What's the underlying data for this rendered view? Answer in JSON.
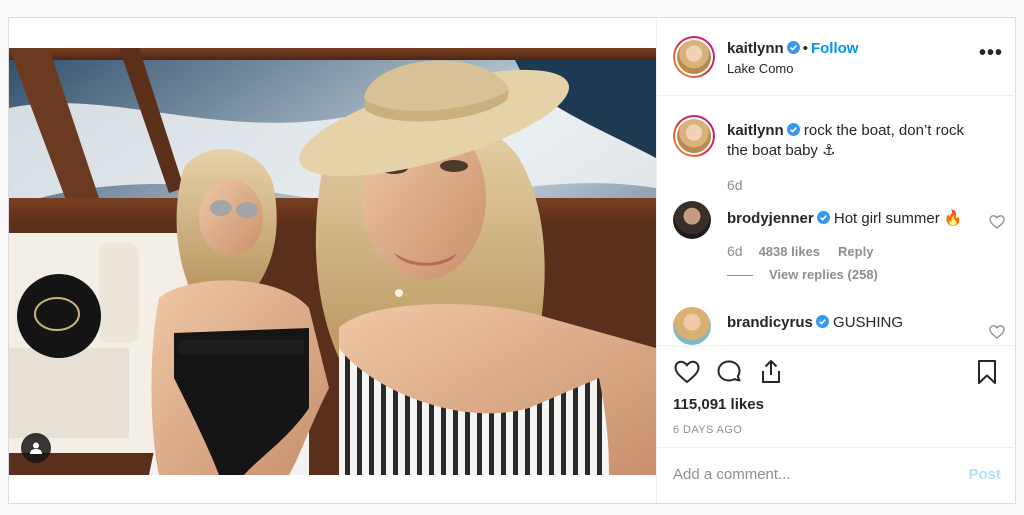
{
  "post": {
    "author": "kaitlynn",
    "follow_label": "Follow",
    "separator": "•",
    "location": "Lake Como",
    "more_label": "•••",
    "caption": {
      "username": "kaitlynn",
      "text": "rock the boat, don’t rock the boat baby ⚓",
      "age": "6d"
    },
    "comments": [
      {
        "username": "brodyjenner",
        "text": "Hot girl summer 🔥",
        "age": "6d",
        "likes": "4838 likes",
        "reply_label": "Reply",
        "view_replies": "View replies (258)"
      },
      {
        "username": "brandicyrus",
        "text": "GUSHING"
      }
    ],
    "like_count": "115,091 likes",
    "time_ago": "6 DAYS AGO",
    "add_comment_placeholder": "Add a comment...",
    "post_label": "Post"
  },
  "icons": [
    "verified-badge-icon",
    "more-options-icon",
    "heart-icon",
    "comment-icon",
    "share-icon",
    "bookmark-icon",
    "user-tag-icon"
  ],
  "colors": {
    "link_blue": "#0095f6",
    "post_disabled": "#b2dffc",
    "verified": "#3897f0",
    "muted": "#8e8e8e"
  }
}
